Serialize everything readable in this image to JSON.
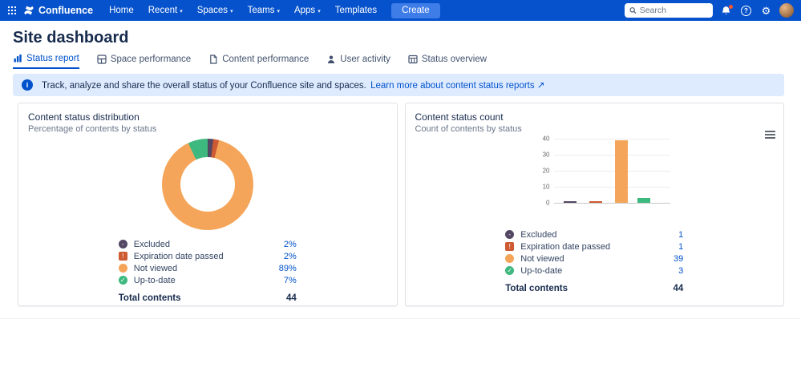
{
  "theme": {
    "nav_bg": "#0652CC",
    "create_bg": "#3E7CE8",
    "link": "#0052CC",
    "banner_bg": "#DEEBFF",
    "title": "#172B4D"
  },
  "nav": {
    "brand": "Confluence",
    "items": [
      {
        "label": "Home",
        "dropdown": false
      },
      {
        "label": "Recent",
        "dropdown": true
      },
      {
        "label": "Spaces",
        "dropdown": true
      },
      {
        "label": "Teams",
        "dropdown": true
      },
      {
        "label": "Apps",
        "dropdown": true
      },
      {
        "label": "Templates",
        "dropdown": false
      }
    ],
    "create_label": "Create",
    "search": {
      "placeholder": "Search"
    },
    "icon_names": [
      "app-switcher-icon",
      "notifications-icon",
      "help-icon",
      "settings-gear-icon",
      "user-avatar"
    ]
  },
  "page_title": "Site dashboard",
  "tabs": [
    {
      "label": "Status report",
      "icon": "bar-chart-icon",
      "active": true
    },
    {
      "label": "Space performance",
      "icon": "space-layout-icon",
      "active": false
    },
    {
      "label": "Content performance",
      "icon": "page-icon",
      "active": false
    },
    {
      "label": "User activity",
      "icon": "user-icon",
      "active": false
    },
    {
      "label": "Status overview",
      "icon": "table-grid-icon",
      "active": false
    }
  ],
  "banner": {
    "text": "Track, analyze and share the overall status of your Confluence site and spaces.",
    "link_text": "Learn more about content status reports ↗"
  },
  "statuses": [
    {
      "name": "Excluded",
      "glyph": "-",
      "color": "#544763"
    },
    {
      "name": "Expiration date passed",
      "glyph": "!",
      "color": "#CD5A32"
    },
    {
      "name": "Not viewed",
      "glyph": "",
      "color": "#F5A55A"
    },
    {
      "name": "Up-to-date",
      "glyph": "✓",
      "color": "#3DB87E"
    }
  ],
  "left_card": {
    "title": "Content status distribution",
    "subtitle": "Percentage of contents by status",
    "legend": [
      {
        "label": "Excluded",
        "value": "2%"
      },
      {
        "label": "Expiration date passed",
        "value": "2%"
      },
      {
        "label": "Not viewed",
        "value": "89%"
      },
      {
        "label": "Up-to-date",
        "value": "7%"
      }
    ],
    "total_label": "Total contents",
    "total_value": "44"
  },
  "right_card": {
    "title": "Content status count",
    "subtitle": "Count of contents by status",
    "legend": [
      {
        "label": "Excluded",
        "value": "1"
      },
      {
        "label": "Expiration date passed",
        "value": "1"
      },
      {
        "label": "Not viewed",
        "value": "39"
      },
      {
        "label": "Up-to-date",
        "value": "3"
      }
    ],
    "total_label": "Total contents",
    "total_value": "44"
  },
  "chart_data": [
    {
      "type": "pie",
      "title": "Content status distribution",
      "subtitle": "Percentage of contents by status",
      "categories": [
        "Excluded",
        "Expiration date passed",
        "Not viewed",
        "Up-to-date"
      ],
      "values": [
        2,
        2,
        89,
        7
      ],
      "unit": "%",
      "colors": [
        "#544763",
        "#CD5A32",
        "#F5A55A",
        "#3DB87E"
      ],
      "donut": true,
      "legend_position": "bottom"
    },
    {
      "type": "bar",
      "title": "Content status count",
      "subtitle": "Count of contents by status",
      "categories": [
        "Excluded",
        "Expiration date passed",
        "Not viewed",
        "Up-to-date"
      ],
      "values": [
        1,
        1,
        39,
        3
      ],
      "colors": [
        "#544763",
        "#CD5A32",
        "#F5A55A",
        "#3DB87E"
      ],
      "ylim": [
        0,
        40
      ],
      "yticks": [
        0,
        10,
        20,
        30,
        40
      ],
      "grid": true,
      "legend_position": "bottom"
    }
  ]
}
